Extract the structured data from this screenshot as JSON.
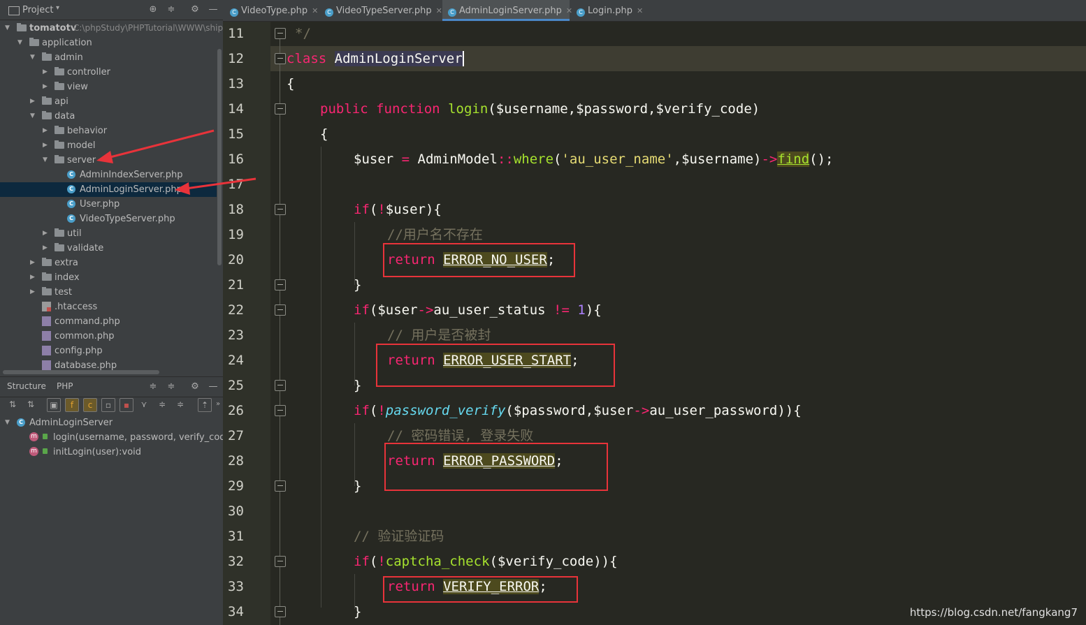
{
  "project_panel": {
    "title": "Project",
    "tree": [
      {
        "label": "tomatotv",
        "path": "C:\\phpStudy\\PHPTutorial\\WWW\\ship"
      },
      {
        "label": "application"
      },
      {
        "label": "admin"
      },
      {
        "label": "controller"
      },
      {
        "label": "view"
      },
      {
        "label": "api"
      },
      {
        "label": "data"
      },
      {
        "label": "behavior"
      },
      {
        "label": "model"
      },
      {
        "label": "server"
      },
      {
        "label": "AdminIndexServer.php"
      },
      {
        "label": "AdminLoginServer.php"
      },
      {
        "label": "User.php"
      },
      {
        "label": "VideoTypeServer.php"
      },
      {
        "label": "util"
      },
      {
        "label": "validate"
      },
      {
        "label": "extra"
      },
      {
        "label": "index"
      },
      {
        "label": "test"
      },
      {
        "label": ".htaccess"
      },
      {
        "label": "command.php"
      },
      {
        "label": "common.php"
      },
      {
        "label": "config.php"
      },
      {
        "label": "database.php"
      }
    ]
  },
  "structure_panel": {
    "tabs": [
      "Structure",
      "PHP"
    ],
    "class_name": "AdminLoginServer",
    "members": [
      "login(username, password, verify_code):",
      "initLogin(user):void"
    ]
  },
  "editor_tabs": [
    {
      "label": "VideoType.php",
      "active": false
    },
    {
      "label": "VideoTypeServer.php",
      "active": false
    },
    {
      "label": "AdminLoginServer.php",
      "active": true
    },
    {
      "label": "Login.php",
      "active": false
    }
  ],
  "line_numbers": [
    "11",
    "12",
    "13",
    "14",
    "15",
    "16",
    "17",
    "18",
    "19",
    "20",
    "21",
    "22",
    "23",
    "24",
    "25",
    "26",
    "27",
    "28",
    "29",
    "30",
    "31",
    "32",
    "33",
    "34"
  ],
  "code": {
    "l11": "*/",
    "l12_kw": "class",
    "l12_name": "AdminLoginServer",
    "l13": "{",
    "l14_kw1": "public",
    "l14_kw2": "function",
    "l14_fn": "login",
    "l14_args": "($username,$password,$verify_code)",
    "l15": "{",
    "l16_a": "$user ",
    "l16_op": "=",
    "l16_b": " AdminModel",
    "l16_dc": "::",
    "l16_where": "where",
    "l16_p1": "(",
    "l16_str": "'au_user_name'",
    "l16_c": ",$username)",
    "l16_arrow": "->",
    "l16_find": "find",
    "l16_end": "();",
    "l18_if": "if",
    "l18_p": "(",
    "l18_not": "!",
    "l18_rest": "$user){",
    "l19": "//用户名不存在",
    "l20_ret": "return",
    "l20_const": "ERROR_NO_USER",
    "l20_semi": ";",
    "l21": "}",
    "l22_if": "if",
    "l22_a": "($user",
    "l22_arrow": "->",
    "l22_b": "au_user_status ",
    "l22_ne": "!=",
    "l22_sp": " ",
    "l22_num": "1",
    "l22_end": "){",
    "l23": "// 用户是否被封",
    "l24_ret": "return",
    "l24_const": "ERROR_USER_START",
    "l24_semi": ";",
    "l25": "}",
    "l26_if": "if",
    "l26_p": "(",
    "l26_not": "!",
    "l26_fn": "password_verify",
    "l26_a": "($password,$user",
    "l26_arrow": "->",
    "l26_b": "au_user_password)){",
    "l27": "// 密码错误, 登录失败",
    "l28_ret": "return",
    "l28_const": "ERROR_PASSWORD",
    "l28_semi": ";",
    "l29": "}",
    "l31": "// 验证验证码",
    "l32_if": "if",
    "l32_p": "(",
    "l32_not": "!",
    "l32_fn": "captcha_check",
    "l32_rest": "($verify_code)){",
    "l33_ret": "return",
    "l33_const": "VERIFY_ERROR",
    "l33_semi": ";",
    "l34": "}"
  },
  "watermark": "https://blog.csdn.net/fangkang7",
  "colors": {
    "highlight_box": "#e8333a",
    "annotation_arrow": "#e8333a",
    "selection": "#0d293e"
  }
}
